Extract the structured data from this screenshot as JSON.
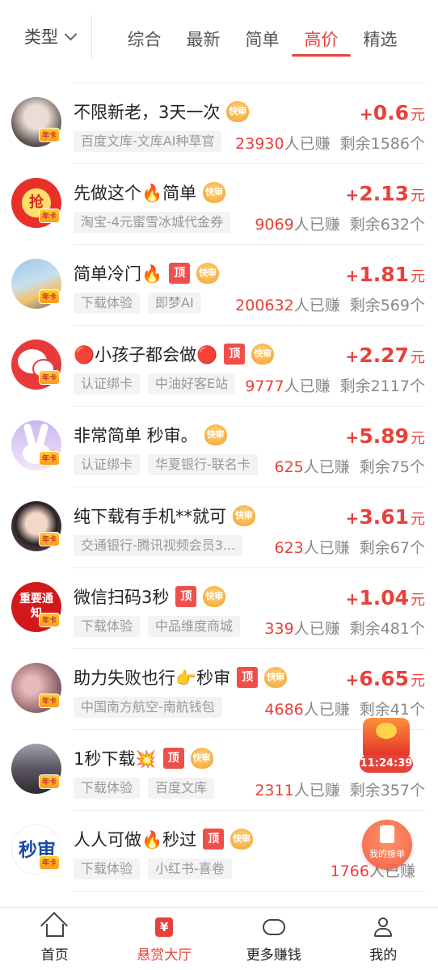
{
  "topbar": {
    "type_filter": "类型",
    "tabs": [
      {
        "label": "综合",
        "active": false
      },
      {
        "label": "最新",
        "active": false
      },
      {
        "label": "简单",
        "active": false
      },
      {
        "label": "高价",
        "active": true
      },
      {
        "label": "精选",
        "active": false
      }
    ]
  },
  "accent_color": "#e8413a",
  "avatar_badge": "年卡",
  "fast_badge": "快审",
  "top_badge": "顶",
  "earned_suffix": "人已赚",
  "remaining_prefix": "剩余",
  "remaining_suffix": "个",
  "unit": "元",
  "tasks": [
    {
      "title": "不限新老，3天一次",
      "top": false,
      "tags": [
        "百度文库-文库AI种草官"
      ],
      "reward": "0.6",
      "earned": "23930",
      "remaining": "1586",
      "avatar_text": ""
    },
    {
      "title": "先做这个🔥简单",
      "top": false,
      "tags": [
        "淘宝-4元蜜雪冰城代金券"
      ],
      "reward": "2.13",
      "earned": "9069",
      "remaining": "632",
      "avatar_text": "抢"
    },
    {
      "title": "简单冷门🔥",
      "top": true,
      "tags": [
        "下载体验",
        "即梦AI"
      ],
      "reward": "1.81",
      "earned": "200632",
      "remaining": "569",
      "avatar_text": ""
    },
    {
      "title": "🔴小孩子都会做🔴",
      "top": true,
      "tags": [
        "认证绑卡",
        "中油好客E站"
      ],
      "reward": "2.27",
      "earned": "9777",
      "remaining": "2117",
      "avatar_text": ""
    },
    {
      "title": "非常简单 秒审。",
      "top": false,
      "tags": [
        "认证绑卡",
        "华夏银行-联名卡"
      ],
      "reward": "5.89",
      "earned": "625",
      "remaining": "75",
      "avatar_text": ""
    },
    {
      "title": "纯下载有手机**就可",
      "top": false,
      "tags": [
        "交通银行-腾讯视频会员3..."
      ],
      "reward": "3.61",
      "earned": "623",
      "remaining": "67",
      "avatar_text": ""
    },
    {
      "title": "微信扫码3秒",
      "top": true,
      "tags": [
        "下载体验",
        "中品维度商城"
      ],
      "reward": "1.04",
      "earned": "339",
      "remaining": "481",
      "avatar_text": "重要通知"
    },
    {
      "title": "助力失败也行👉秒审",
      "top": true,
      "tags": [
        "中国南方航空-南航钱包"
      ],
      "reward": "6.65",
      "earned": "4686",
      "remaining": "41",
      "avatar_text": ""
    },
    {
      "title": "1秒下载💥",
      "top": true,
      "tags": [
        "下载体验",
        "百度文库"
      ],
      "reward": "",
      "earned": "2311",
      "remaining": "357",
      "avatar_text": ""
    },
    {
      "title": "人人可做🔥秒过",
      "top": true,
      "tags": [
        "下载体验",
        "小红书-喜卷"
      ],
      "reward": "",
      "earned": "1766",
      "remaining": "",
      "avatar_text": "秒审"
    }
  ],
  "float_timer": "11:24:39",
  "float_orders": "我的接单",
  "bottom_nav": [
    {
      "label": "首页",
      "icon": "home-icon",
      "active": false
    },
    {
      "label": "悬赏大厅",
      "icon": "reward-hall-icon",
      "active": true
    },
    {
      "label": "更多赚钱",
      "icon": "gamepad-icon",
      "active": false
    },
    {
      "label": "我的",
      "icon": "user-icon",
      "active": false
    }
  ]
}
